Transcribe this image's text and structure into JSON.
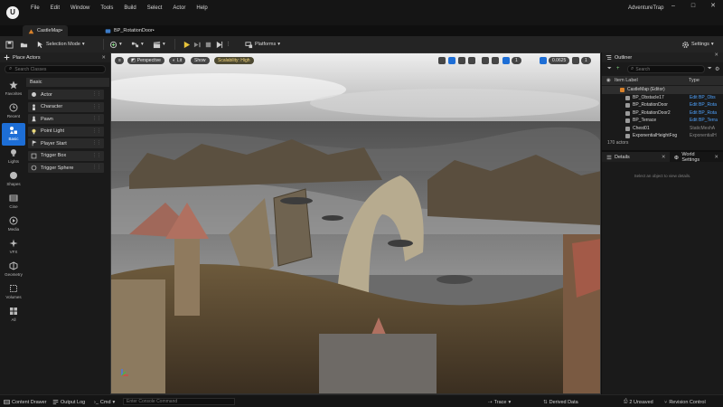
{
  "menu": {
    "items": [
      "File",
      "Edit",
      "Window",
      "Tools",
      "Build",
      "Select",
      "Actor",
      "Help"
    ],
    "app_title": "AdventureTrap"
  },
  "tabs": {
    "level": "CastleMap•",
    "blueprint": "BP_RotationDoor•"
  },
  "toolbar": {
    "mode": "Selection Mode",
    "platforms": "Platforms",
    "settings": "Settings"
  },
  "place_actors": {
    "title": "Place Actors",
    "search_placeholder": "Search Classes",
    "section": "Basic",
    "categories": [
      "Favorites",
      "Recent",
      "Basic",
      "Lights",
      "Shapes",
      "Cine",
      "Media",
      "VFX",
      "Geometry",
      "Volumes",
      "All"
    ],
    "active_category": "Basic",
    "actors": [
      "Actor",
      "Character",
      "Pawn",
      "Point Light",
      "Player Start",
      "Trigger Box",
      "Trigger Sphere"
    ]
  },
  "viewport": {
    "perspective": "Perspective",
    "lit": "Lit",
    "show": "Show",
    "scalability": "Scalability: High",
    "grid_snap": "1",
    "scale_snap": "0.0625",
    "camera_speed": "1"
  },
  "outliner": {
    "title": "Outliner",
    "search_placeholder": "Search",
    "col_label": "Item Label",
    "col_type": "Type",
    "rows": [
      {
        "name": "CastleMap (Editor)",
        "type": ""
      },
      {
        "name": "BP_Obstacle17",
        "type": "Edit BP_Obs"
      },
      {
        "name": "BP_RotationDoor",
        "type": "Edit BP_Rota"
      },
      {
        "name": "BP_RotationDoor2",
        "type": "Edit BP_Rota"
      },
      {
        "name": "BP_Terrace",
        "type": "Edit BP_Terra"
      },
      {
        "name": "Chest01",
        "type": "StaticMeshA"
      },
      {
        "name": "ExponentialHeightFog",
        "type": "ExponentialH"
      }
    ],
    "count": "170 actors"
  },
  "details": {
    "title": "Details",
    "world_settings": "World Settings",
    "empty_text": "Select an object to view details."
  },
  "statusbar": {
    "content_drawer": "Content Drawer",
    "output_log": "Output Log",
    "cmd": "Cmd",
    "console_placeholder": "Enter Console Command",
    "trace": "Trace",
    "derived_data": "Derived Data",
    "unsaved": "2 Unsaved",
    "revision_control": "Revision Control"
  },
  "colors": {
    "accent": "#1d6ed6",
    "play": "#e7c23a",
    "link": "#4fa3ff",
    "scalability": "#f1d37a"
  }
}
